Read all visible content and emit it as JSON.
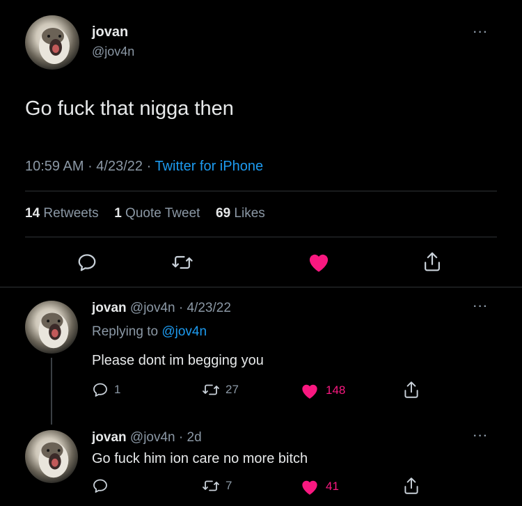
{
  "main_tweet": {
    "display_name": "jovan",
    "handle": "@jov4n",
    "text": "Go fuck that nigga then",
    "time": "10:59 AM",
    "date": "4/23/22",
    "source": "Twitter for iPhone",
    "retweets_count": "14",
    "retweets_label": "Retweets",
    "quotes_count": "1",
    "quotes_label": "Quote Tweet",
    "likes_count": "69",
    "likes_label": "Likes"
  },
  "replies": [
    {
      "display_name": "jovan",
      "handle": "@jov4n",
      "date": "4/23/22",
      "replying_label": "Replying to",
      "replying_to": "@jov4n",
      "text": "Please dont im begging you",
      "reply_count": "1",
      "retweet_count": "27",
      "like_count": "148"
    },
    {
      "display_name": "jovan",
      "handle": "@jov4n",
      "date": "2d",
      "text": "Go fuck him ion care no more bitch",
      "reply_count": "",
      "retweet_count": "7",
      "like_count": "41"
    }
  ],
  "colors": {
    "background": "#000000",
    "like_active": "#f91880",
    "link": "#1d9bf0",
    "muted": "#8b98a5"
  },
  "icons": [
    "reply-icon",
    "retweet-icon",
    "heart-icon",
    "share-icon",
    "more-icon"
  ]
}
